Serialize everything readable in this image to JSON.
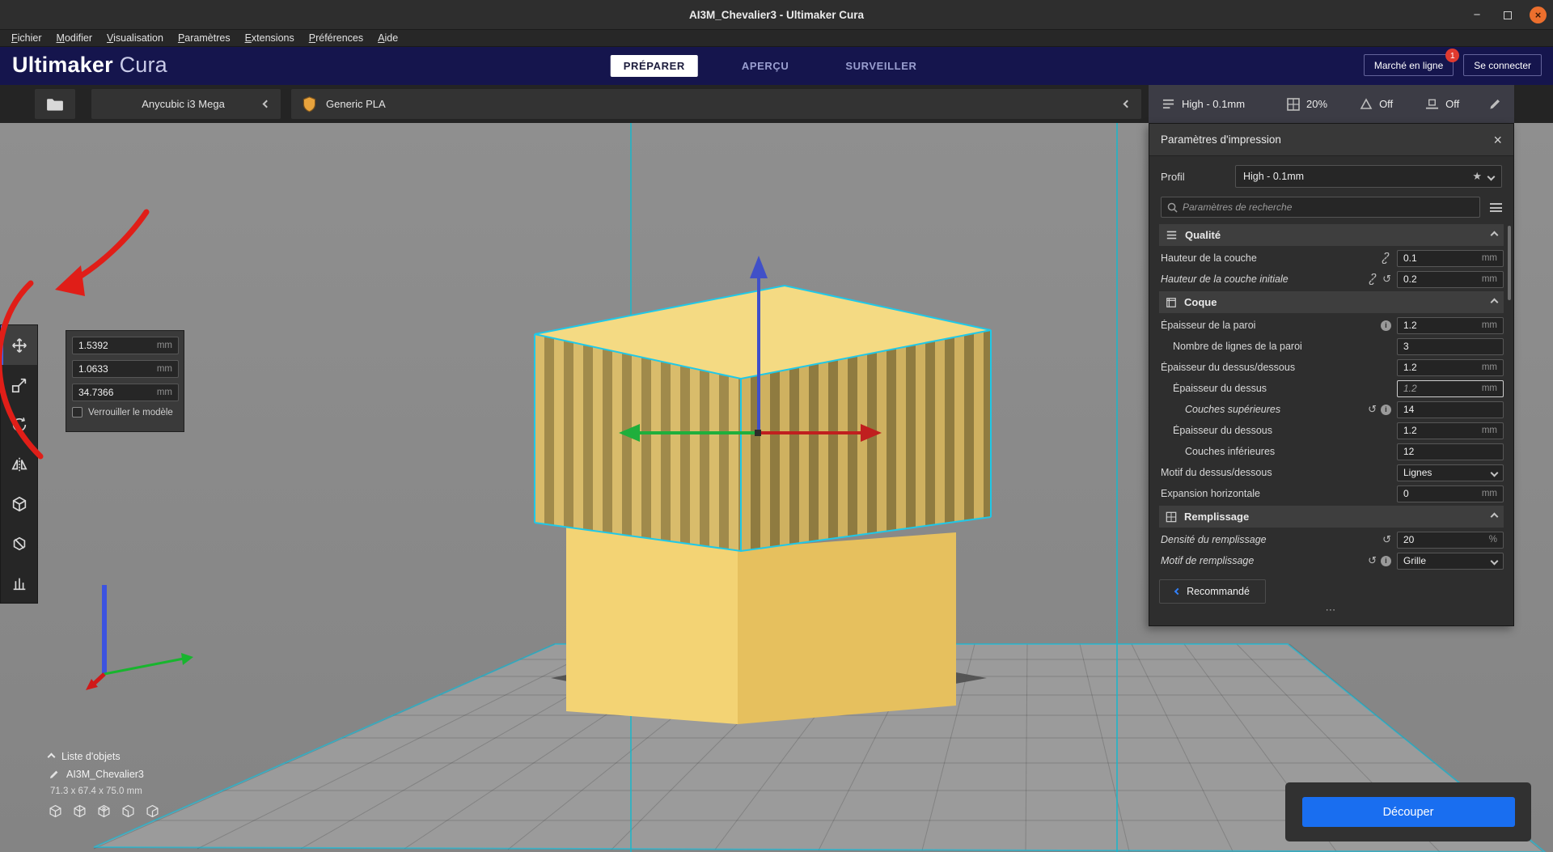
{
  "window": {
    "title": "AI3M_Chevalier3 - Ultimaker Cura"
  },
  "menu": {
    "items": [
      "Fichier",
      "Modifier",
      "Visualisation",
      "Paramètres",
      "Extensions",
      "Préférences",
      "Aide"
    ]
  },
  "header": {
    "brand_bold": "Ultimaker",
    "brand_light": "Cura",
    "tabs": [
      {
        "label": "PRÉPARER"
      },
      {
        "label": "APERÇU"
      },
      {
        "label": "SURVEILLER"
      }
    ],
    "marketplace": "Marché en ligne",
    "marketplace_badge": "1",
    "sign_in": "Se connecter"
  },
  "configbar": {
    "printer": "Anycubic i3 Mega",
    "material": "Generic PLA"
  },
  "summary": {
    "profile": "High - 0.1mm",
    "infill": "20%",
    "support": "Off",
    "adhesion": "Off"
  },
  "panel": {
    "title": "Paramètres d'impression",
    "profile_label": "Profil",
    "profile_value": "High - 0.1mm",
    "search_placeholder": "Paramètres de recherche",
    "recommended": "Recommandé",
    "rows": [
      {
        "type": "section",
        "label": "Qualité"
      },
      {
        "label": "Hauteur de la couche",
        "value": "0.1",
        "unit": "mm"
      },
      {
        "label": "Hauteur de la couche initiale",
        "value": "0.2",
        "unit": "mm"
      },
      {
        "type": "section",
        "label": "Coque"
      },
      {
        "label": "Épaisseur de la paroi",
        "value": "1.2",
        "unit": "mm"
      },
      {
        "label": "Nombre de lignes de la paroi",
        "value": "3",
        "unit": ""
      },
      {
        "label": "Épaisseur du dessus/dessous",
        "value": "1.2",
        "unit": "mm"
      },
      {
        "label": "Épaisseur du dessus",
        "value": "1.2",
        "unit": "mm"
      },
      {
        "label": "Couches supérieures",
        "value": "14",
        "unit": ""
      },
      {
        "label": "Épaisseur du dessous",
        "value": "1.2",
        "unit": "mm"
      },
      {
        "label": "Couches inférieures",
        "value": "12",
        "unit": ""
      },
      {
        "label": "Motif du dessus/dessous",
        "value": "Lignes",
        "unit": ""
      },
      {
        "label": "Expansion horizontale",
        "value": "0",
        "unit": "mm"
      },
      {
        "type": "section",
        "label": "Remplissage"
      },
      {
        "label": "Densité du remplissage",
        "value": "20",
        "unit": "%"
      },
      {
        "label": "Motif de remplissage",
        "value": "Grille",
        "unit": ""
      }
    ]
  },
  "tool_panel": {
    "x": "1.5392",
    "y": "1.0633",
    "z": "34.7366",
    "unit": "mm",
    "lock_label": "Verrouiller le modèle"
  },
  "object_list": {
    "toggle": "Liste d'objets",
    "name": "AI3M_Chevalier3",
    "dims": "71.3 x 67.4 x 75.0 mm"
  },
  "slice": {
    "label": "Découper"
  },
  "glyphs": {
    "close": "×",
    "minimize": "−",
    "star": "★",
    "revert": "↺",
    "dots": "⋯"
  },
  "colors": {
    "accent_blue": "#196ef0",
    "header_navy": "#15154d",
    "selection_cyan": "#1fc8e8",
    "annotation_red": "#e01e18",
    "model_yellow": "#f3d374"
  }
}
